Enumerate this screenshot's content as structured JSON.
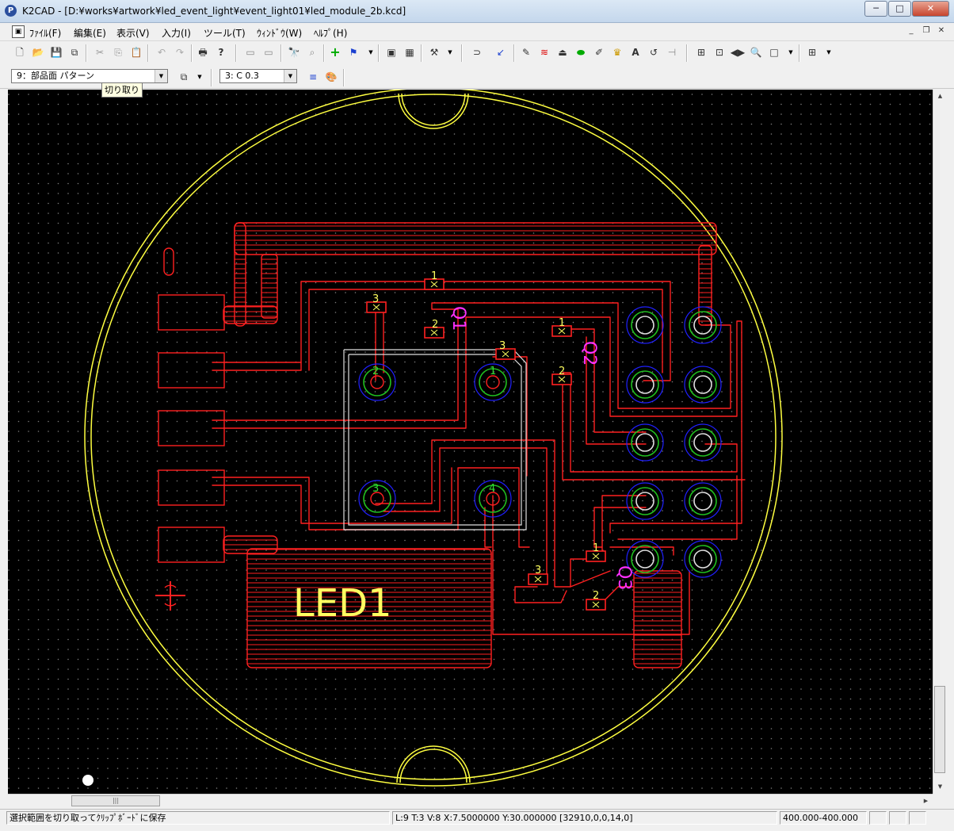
{
  "window": {
    "title": "K2CAD - [D:¥works¥artwork¥led_event_light¥event_light01¥led_module_2b.kcd]",
    "app_icon": "P"
  },
  "menu": {
    "items": [
      "ﾌｧｲﾙ(F)",
      "編集(E)",
      "表示(V)",
      "入力(I)",
      "ツール(T)",
      "ｳｨﾝﾄﾞｳ(W)",
      "ﾍﾙﾌﾟ(H)"
    ]
  },
  "toolbar2": {
    "layer_select": "9：部品面 パターン",
    "width_select": "3: C 0.3"
  },
  "tooltip": "切り取り",
  "canvas": {
    "component_label": "LED1",
    "q1_label": "Q1",
    "q2_label": "Q2",
    "q3_label": "Q3",
    "pin_labels": [
      "1",
      "2",
      "3",
      "1",
      "2",
      "3",
      "1",
      "2",
      "3"
    ],
    "led_pin_labels": [
      "2",
      "1",
      "3",
      "4"
    ],
    "colors": {
      "background": "#000000",
      "trace": "#ff2020",
      "outline": "#ffff40",
      "silk_label": "#ffff60",
      "ref_label": "#ff30ff",
      "pad_ring": "#20c020",
      "via_ring": "#2020ff",
      "select_box": "#e0e0e0"
    }
  },
  "status": {
    "message": "選択範囲を切り取ってｸﾘｯﾌﾟﾎﾞｰﾄﾞに保存",
    "coords": "L:9 T:3 V:8 X:7.5000000 Y:30.000000 [32910,0,0,14,0]",
    "zoom": "400.000-400.000"
  }
}
